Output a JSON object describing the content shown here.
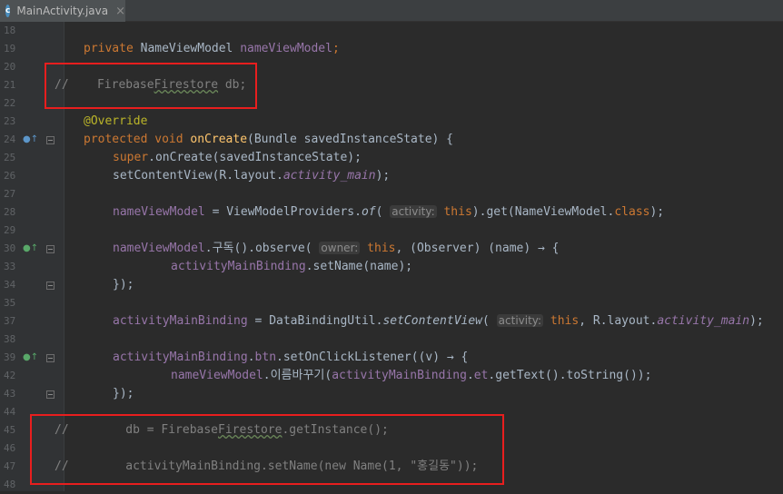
{
  "tab": {
    "icon": "c",
    "label": "MainActivity.java",
    "close": "×"
  },
  "line_numbers": [
    "18",
    "19",
    "20",
    "21",
    "22",
    "23",
    "24",
    "25",
    "26",
    "27",
    "28",
    "29",
    "30",
    "33",
    "34",
    "35",
    "37",
    "38",
    "39",
    "42",
    "43",
    "44",
    "45",
    "46",
    "47",
    "48"
  ],
  "code": {
    "l19": {
      "a": "private ",
      "b": "NameViewModel ",
      "c": "nameViewModel",
      "d": ";"
    },
    "l21": {
      "a": "//    Firebase",
      "b": "Firestore",
      "c": " db;"
    },
    "l23": {
      "a": "@Override"
    },
    "l24": {
      "a": "protected void ",
      "b": "onCreate",
      "c": "(Bundle savedInstanceState) {"
    },
    "l25": {
      "a": "super",
      "b": ".onCreate(savedInstanceState);"
    },
    "l26": {
      "a": "setContentView(R.layout.",
      "b": "activity_main",
      "c": ");"
    },
    "l28": {
      "a": "nameViewModel",
      "b": " = ViewModelProviders.",
      "c": "of",
      "d": "( ",
      "hint": "activity:",
      "e": " this",
      "f": ").get(NameViewModel.",
      "g": "class",
      "h": ");"
    },
    "l30": {
      "a": "nameViewModel",
      "b": ".구독().observe( ",
      "hint": "owner:",
      "c": " this",
      "d": ", (Observer) (name) → {"
    },
    "l33": {
      "a": "activityMainBinding",
      "b": ".setName(name);"
    },
    "l34": {
      "a": "});"
    },
    "l37": {
      "a": "activityMainBinding",
      "b": " = DataBindingUtil.",
      "c": "setContentView",
      "d": "( ",
      "hint": "activity:",
      "e": " this",
      "f": ", R.layout.",
      "g": "activity_main",
      "h": ");"
    },
    "l39": {
      "a": "activityMainBinding",
      "b": ".",
      "c": "btn",
      "d": ".setOnClickListener((v) → {"
    },
    "l42": {
      "a": "nameViewModel",
      "b": ".이름바꾸기(",
      "c": "activityMainBinding",
      "d": ".",
      "e": "et",
      "f": ".getText().toString());"
    },
    "l43": {
      "a": "});"
    },
    "l46": {
      "a": "//        db = Firebase",
      "b": "Firestore",
      "c": ".getInstance();"
    },
    "l48": {
      "a": "//        activityMainBinding.setName(new Name(1, \"홍길동\"));"
    }
  },
  "colors": {
    "background": "#2b2b2b",
    "keyword": "#cc7832",
    "field": "#9876aa",
    "method": "#ffc66d",
    "comment": "#808080",
    "highlight": "#e81e1e"
  },
  "gutter_icons": {
    "l24": "override-icon",
    "l30": "lambda-icon",
    "l39": "lambda-icon"
  }
}
